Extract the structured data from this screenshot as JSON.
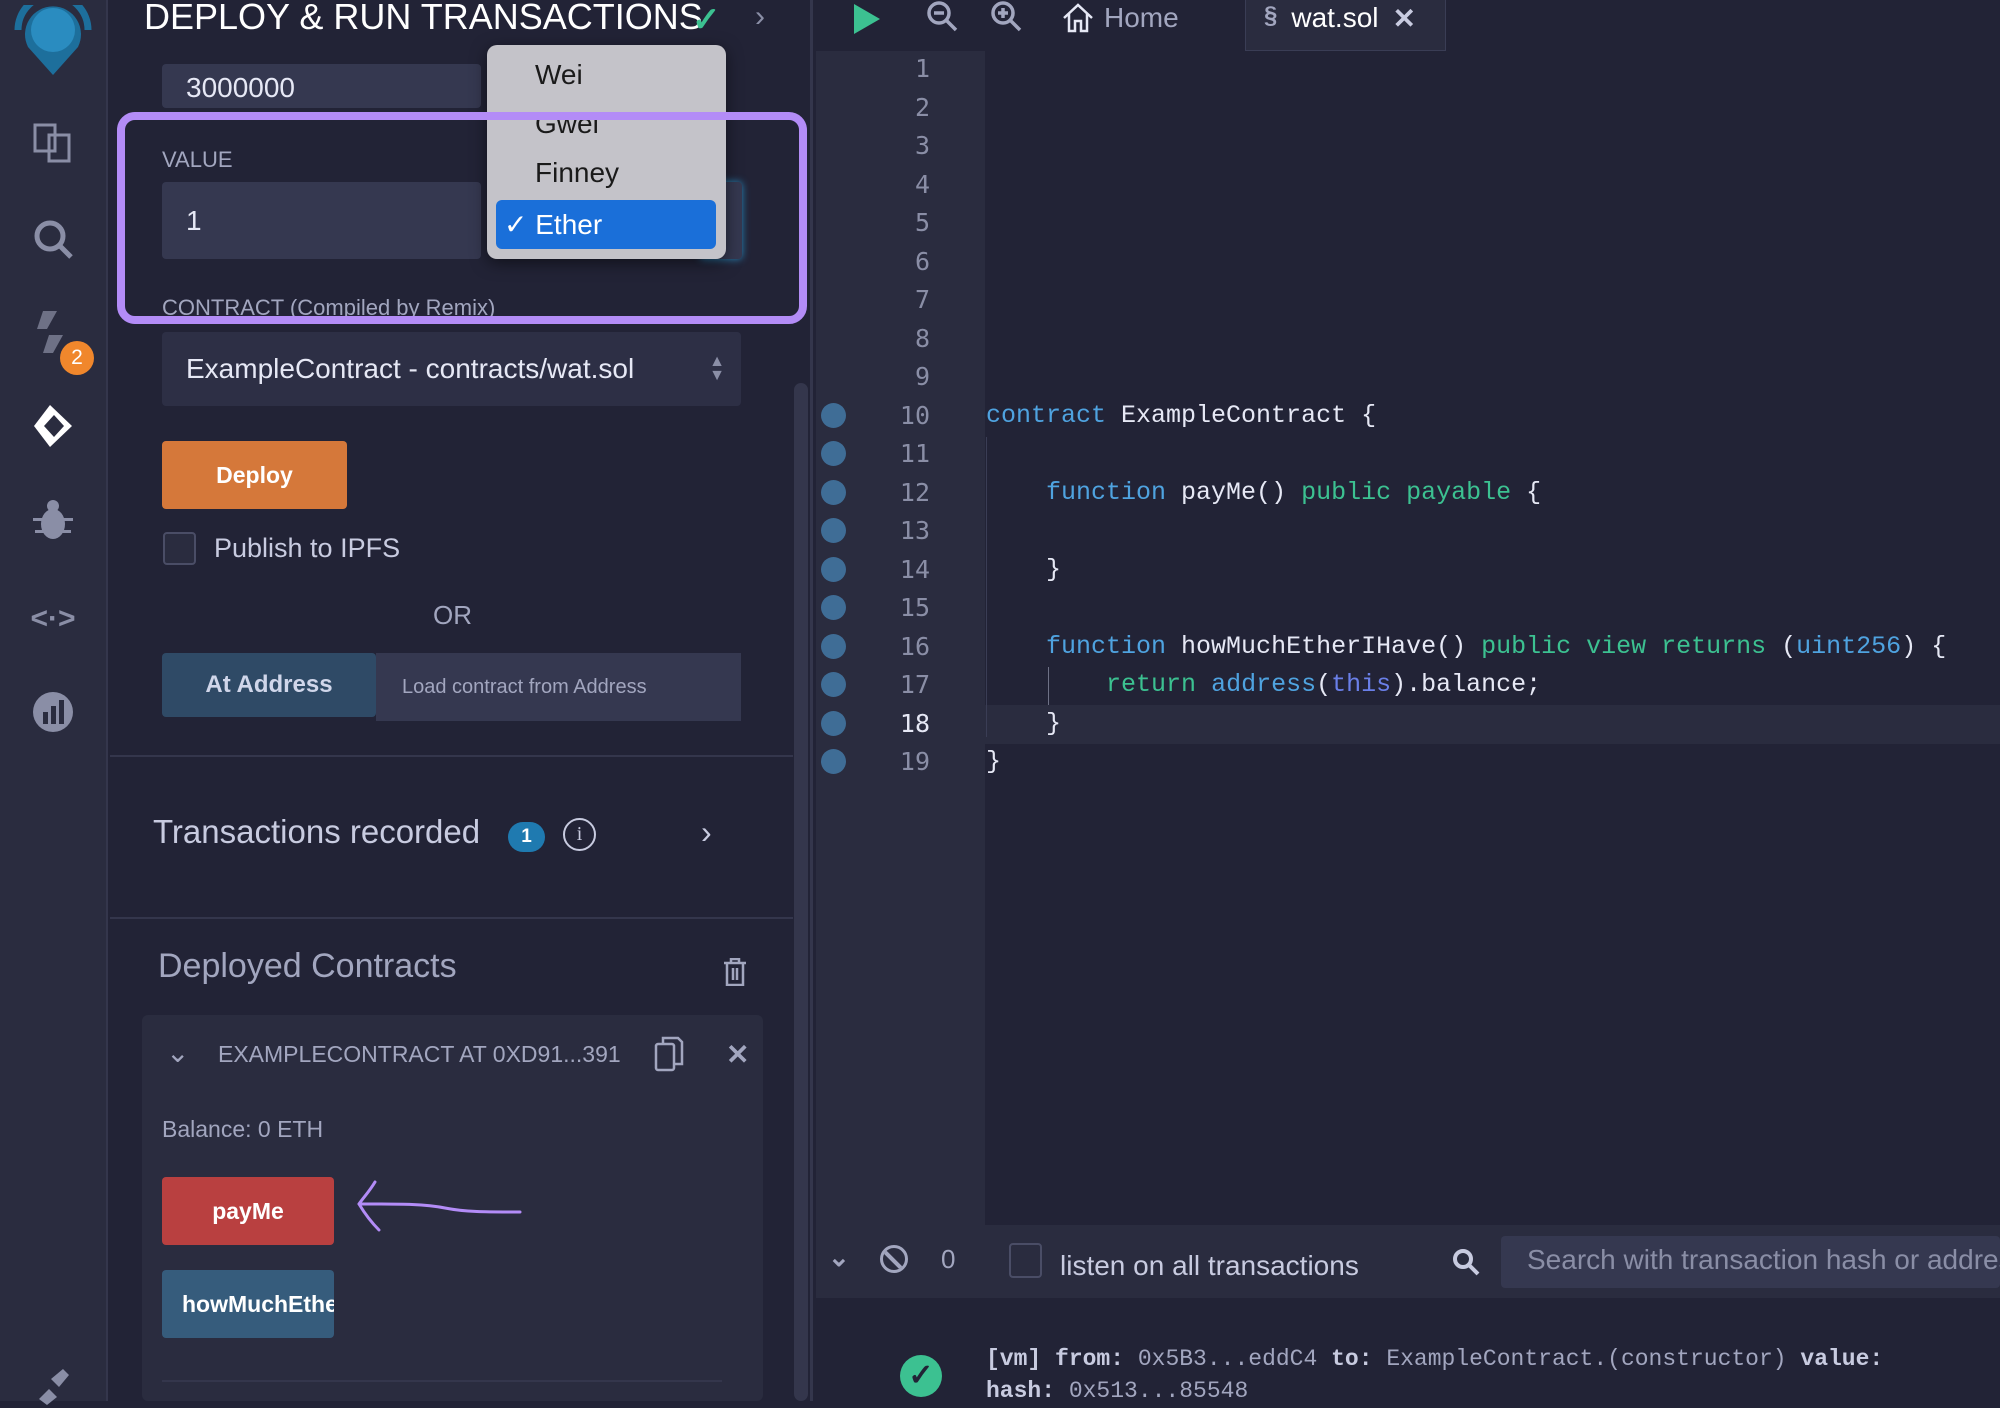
{
  "sidebar": {
    "badge": "2",
    "icons": [
      "remix-logo-icon",
      "file-explorer-icon",
      "search-icon",
      "solidity-compiler-icon",
      "deploy-run-icon",
      "debugger-icon",
      "udapp-icon",
      "analysis-icon",
      "plugin-icon"
    ]
  },
  "panel": {
    "title": "DEPLOY & RUN TRANSACTIONS",
    "gas_limit_value": "3000000",
    "value_label": "VALUE",
    "value_input": "1",
    "unit_options": [
      "Wei",
      "Gwei",
      "Finney",
      "Ether"
    ],
    "unit_selected": "Ether",
    "contract_label": "CONTRACT (Compiled by Remix)",
    "contract_select": "ExampleContract - contracts/wat.sol",
    "deploy_label": "Deploy",
    "publish_ipfs_label": "Publish to IPFS",
    "or_label": "OR",
    "at_address_label": "At Address",
    "at_address_placeholder": "Load contract from Address",
    "transactions_recorded_label": "Transactions recorded",
    "transactions_recorded_count": "1",
    "deployed_contracts_label": "Deployed Contracts",
    "instance": {
      "title": "EXAMPLECONTRACT AT 0XD91...391",
      "balance": "Balance: 0 ETH",
      "functions": [
        {
          "label": "payMe",
          "color": "#b94040"
        },
        {
          "label": "howMuchEthe",
          "color": "#365c7c"
        }
      ]
    }
  },
  "editor": {
    "tabs": [
      {
        "label": "Home"
      },
      {
        "label": "wat.sol",
        "active": true
      }
    ],
    "line_numbers": [
      "1",
      "2",
      "3",
      "4",
      "5",
      "6",
      "7",
      "8",
      "9",
      "10",
      "11",
      "12",
      "13",
      "14",
      "15",
      "16",
      "17",
      "18",
      "19"
    ],
    "active_line": "18",
    "code": {
      "10": [
        [
          "contract",
          "kw"
        ],
        [
          " ExampleContract {",
          ""
        ]
      ],
      "12": [
        [
          "    ",
          ""
        ],
        [
          "function",
          "kw"
        ],
        [
          " payMe() ",
          ""
        ],
        [
          "public payable",
          "gr"
        ],
        [
          " {",
          ""
        ]
      ],
      "14": [
        [
          "    }",
          ""
        ]
      ],
      "16": [
        [
          "    ",
          ""
        ],
        [
          "function",
          "kw"
        ],
        [
          " howMuchEtherIHave() ",
          ""
        ],
        [
          "public view returns",
          "gr"
        ],
        [
          " (",
          ""
        ],
        [
          "uint256",
          "ty"
        ],
        [
          ") {",
          ""
        ]
      ],
      "17": [
        [
          "        ",
          ""
        ],
        [
          "return",
          "gr"
        ],
        [
          " ",
          ""
        ],
        [
          "address",
          "kw"
        ],
        [
          "(",
          ""
        ],
        [
          "this",
          "th"
        ],
        [
          ").balance;",
          ""
        ]
      ],
      "18": [
        [
          "    }",
          ""
        ]
      ],
      "19": [
        [
          "}",
          ""
        ]
      ]
    }
  },
  "terminal": {
    "pending_count": "0",
    "listen_label": "listen on all transactions",
    "search_placeholder": "Search with transaction hash or address",
    "log_line1": [
      [
        "[vm]",
        "b"
      ],
      [
        " from:",
        "b"
      ],
      [
        " 0x5B3...eddC4 ",
        ""
      ],
      [
        "to:",
        "b"
      ],
      [
        " ExampleContract.(constructor) ",
        ""
      ],
      [
        "value:",
        "b"
      ]
    ],
    "log_line2": [
      [
        "hash:",
        "b"
      ],
      [
        " 0x513...85548",
        ""
      ]
    ]
  },
  "colors": {
    "accent_purple": "#b38cf7",
    "deploy": "#d5783a",
    "select_blue": "#1a6fd9"
  }
}
